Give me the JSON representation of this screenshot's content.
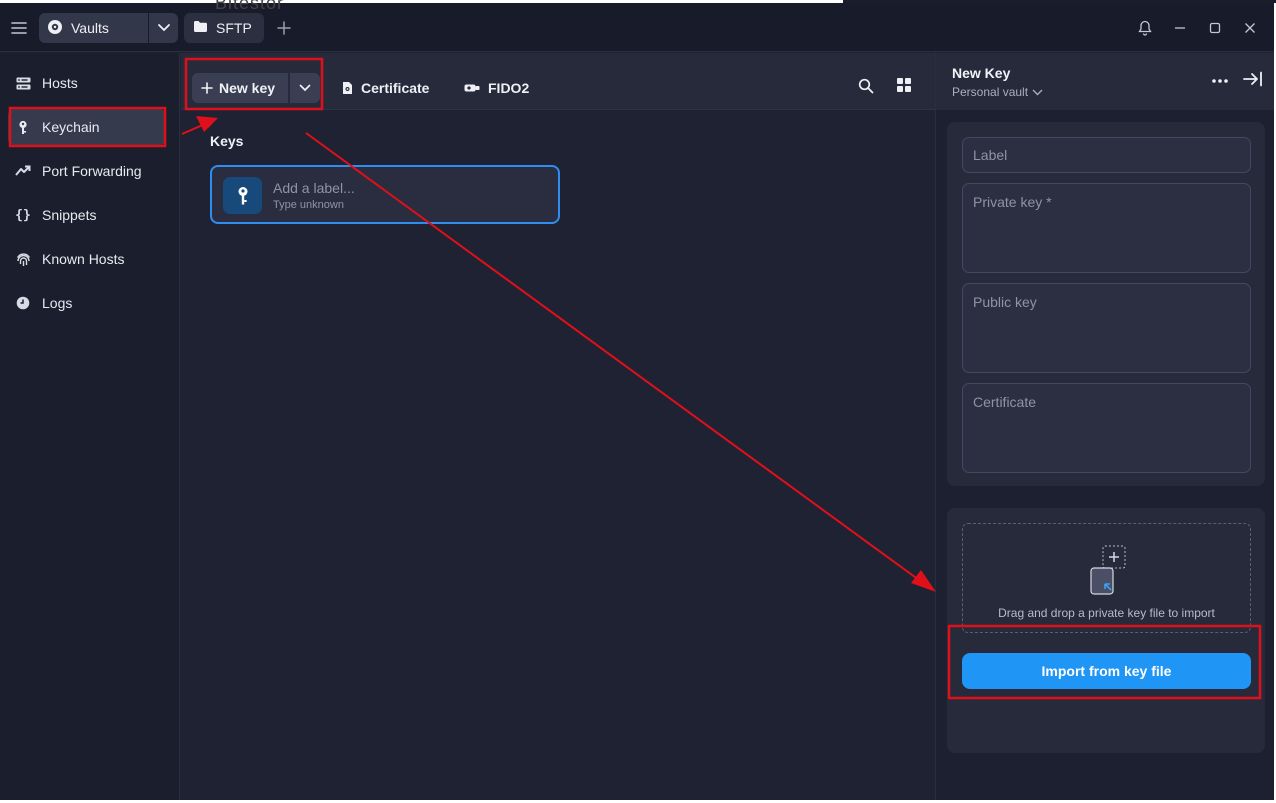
{
  "titlebar": {
    "vaults_tab": "Vaults",
    "sftp_tab": "SFTP"
  },
  "top_cut_text": "Bitestor",
  "sidebar": {
    "items": [
      {
        "label": "Hosts",
        "icon": "hosts-icon"
      },
      {
        "label": "Keychain",
        "icon": "key-icon",
        "active": true
      },
      {
        "label": "Port Forwarding",
        "icon": "port-forwarding-icon"
      },
      {
        "label": "Snippets",
        "icon": "braces-icon"
      },
      {
        "label": "Known Hosts",
        "icon": "fingerprint-icon"
      },
      {
        "label": "Logs",
        "icon": "clock-icon"
      }
    ]
  },
  "toolbar": {
    "new_key": "New key",
    "certificate": "Certificate",
    "fido2": "FIDO2"
  },
  "keys": {
    "title": "Keys",
    "card": {
      "label": "Add a label...",
      "type": "Type unknown"
    }
  },
  "panel": {
    "title": "New Key",
    "vault": "Personal vault",
    "fields": {
      "label": "Label",
      "private_key": "Private key *",
      "public_key": "Public key",
      "certificate": "Certificate"
    },
    "drop_text": "Drag and drop a private key file to import",
    "import_button": "Import from key file"
  },
  "colors": {
    "accent": "#1f95f5",
    "annotation": "#e0101a",
    "background": "#1f2232"
  }
}
